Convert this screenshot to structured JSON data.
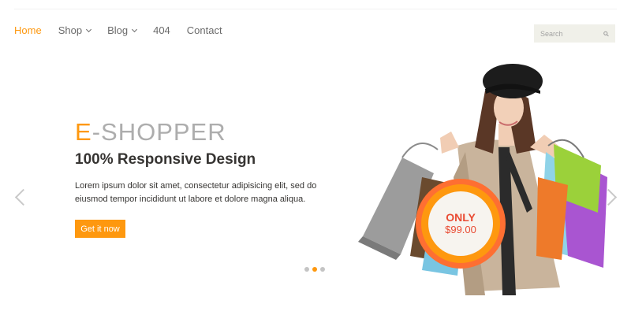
{
  "nav": {
    "items": [
      {
        "label": "Home",
        "active": true,
        "dropdown": false
      },
      {
        "label": "Shop",
        "active": false,
        "dropdown": true
      },
      {
        "label": "Blog",
        "active": false,
        "dropdown": true
      },
      {
        "label": "404",
        "active": false,
        "dropdown": false
      },
      {
        "label": "Contact",
        "active": false,
        "dropdown": false
      }
    ]
  },
  "search": {
    "placeholder": "Search",
    "icon": "search-icon"
  },
  "slider": {
    "brand_first": "E",
    "brand_rest": "-SHOPPER",
    "headline": "100% Responsive Design",
    "description": "Lorem ipsum dolor sit amet, consectetur adipisicing elit, sed do eiusmod tempor incididunt ut labore et dolore magna aliqua.",
    "cta_label": "Get it now",
    "price_only": "ONLY",
    "price_amount": "$99.00",
    "active_slide": 2,
    "slide_count": 3
  },
  "colors": {
    "accent": "#FE980F",
    "text": "#363432",
    "muted": "#adadad",
    "search_bg": "#F0F0E9"
  }
}
